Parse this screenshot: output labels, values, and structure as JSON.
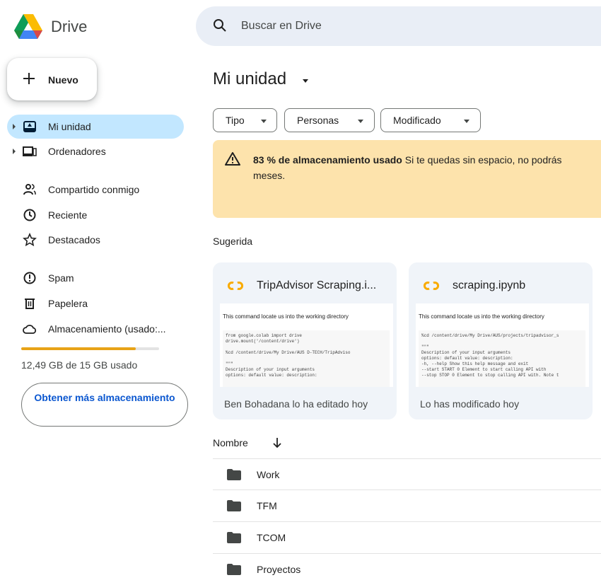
{
  "header": {
    "brand": "Drive",
    "search_placeholder": "Buscar en Drive"
  },
  "new_button": {
    "label": "Nuevo"
  },
  "sidebar": {
    "items": [
      {
        "label": "Mi unidad",
        "icon": "my-drive-icon",
        "active": true
      },
      {
        "label": "Ordenadores",
        "icon": "computers-icon"
      },
      {
        "label": "Compartido conmigo",
        "icon": "shared-icon"
      },
      {
        "label": "Reciente",
        "icon": "clock-icon"
      },
      {
        "label": "Destacados",
        "icon": "star-icon"
      },
      {
        "label": "Spam",
        "icon": "spam-icon"
      },
      {
        "label": "Papelera",
        "icon": "trash-icon"
      },
      {
        "label": "Almacenamiento (usado:...",
        "icon": "cloud-icon"
      }
    ],
    "storage": {
      "used_fraction": 0.83,
      "text": "12,49 GB de 15 GB usado",
      "bar_color": "#e8a317"
    },
    "get_storage_label": "Obtener más almacenamiento"
  },
  "main": {
    "title": "Mi unidad",
    "filters": [
      {
        "label": "Tipo"
      },
      {
        "label": "Personas"
      },
      {
        "label": "Modificado"
      }
    ],
    "banner": {
      "bold": "83 % de almacenamiento usado",
      "text": " Si te quedas sin espacio, no podrás",
      "text2": "meses."
    },
    "suggested_label": "Sugerida",
    "cards": [
      {
        "title": "TripAdvisor Scraping.i...",
        "preview_head": "This command locate us into the working directory",
        "preview_code": "from google.colab import drive\ndrive.mount('/content/drive')\n\n%cd /content/drive/My Drive/AUS D-TECH/TripAdviso\n\n\"\"\"\nDescription of your input arguments\noptions: default value: description:",
        "footer": "Ben Bohadana lo ha editado hoy"
      },
      {
        "title": "scraping.ipynb",
        "preview_head": "This command locate us into the working directory",
        "preview_code": "%cd /content/drive/My Drive/AUS/projects/tripadvisor_s\n\n\"\"\"\nDescription of your input arguments\noptions: default value: description:\n-h, --help Show this help message and exit\n--start START 0 Element to start calling API with\n--stop STOP 0 Element to stop calling API with. Note t",
        "footer": "Lo has modificado hoy"
      }
    ],
    "list_header": "Nombre",
    "folders": [
      "Work",
      "TFM",
      "TCOM",
      "Proyectos"
    ]
  },
  "colors": {
    "accent": "#0b57d0",
    "active_nav": "#c2e7ff",
    "banner": "#fde3ac"
  }
}
